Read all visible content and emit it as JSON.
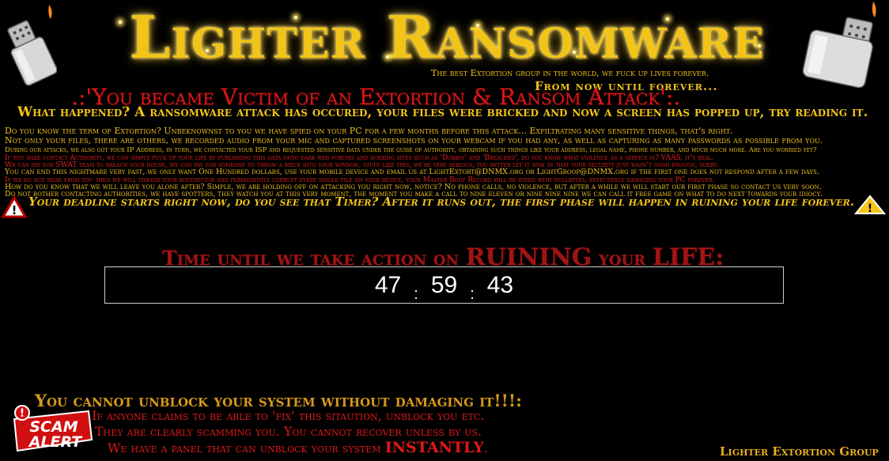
{
  "header": {
    "title": "Lighter Ransomware",
    "tagline_1": "The best Extortion group in the world, we fuck up lives forever.",
    "tagline_2": "From now until forever...",
    "victim_banner": ".:'You became Victim of an Extortion & Ransom Attack':.",
    "what_happened": "What happened? A ransomware attack has occured, your files were bricked and now a screen has popped up, try reading it."
  },
  "body_lines": [
    {
      "text": "Do you know the term of Extortion? Unbeknownst to you we have spied on your PC for a few months before this attack... Exfiltrating many sensitive things, that's right.",
      "color": "yel"
    },
    {
      "text": "Not only your files, there are others, we recorded audio from your mic and captured screenshots on your webcam if you had any, as well as capturing as many passwords as possible from you.",
      "color": "yel"
    },
    {
      "text": "During our attacks, we also got your IP Address, in turn, we contacted your ISP and requested sensitive data under the guise of authority, obtaining such things like your address, legal name, phone number, and much much more. Are you worried yet?",
      "color": "yel"
    },
    {
      "text": "If you dare contact Authority, we can simply fuck up your life by publishing this data onto dark web forums and doxxing sites such as 'Doxbin' and 'Breached', do you know what violence as a service is? VAAS, it's real.",
      "color": "red"
    },
    {
      "text": "We can pay for SWAT team to breach your house, we can pay for someone to throw a brick into your window, stuff like this, we're very serious, you better let it sink in that your security just wasn't good enough, sorry.",
      "color": "red"
    },
    {
      "text": "You can end this nightmare very fast,  we only want One Hundred dollars, use your mobile device and email us at LightExtort@DNMX.org or LightGroop@DNMX.org if the first one does not respond after a few days.",
      "color": "yel"
    },
    {
      "text": "If we do not hear from you then we will thrash your bootsector and permanently corrupt every single file on your device, your Master Boot Record will be wiped with nullbytes, effectively damaging your PC forever.",
      "color": "red"
    },
    {
      "text": "How do you know that we will leave you alone after? Simple, we are holding off on attacking you right now, notice? No phone calls, no violence, but after a while we will start our first phase so contact us very soon.",
      "color": "yel"
    },
    {
      "text": "Do not bother contacting authorities, we have spotters, they watch you at this very moment, the moment you make a call to nine eleven or nine nine nine we can call it free game on what to do next towards your idiocy.",
      "color": "yel"
    }
  ],
  "deadline": "Your deadline starts right now, do you see that Timer? After it runs out, the first phase will happen in ruining your life forever.",
  "timer": {
    "heading_1": "Time until we take action on ",
    "heading_ruining": "RUINING",
    "heading_2": " your ",
    "heading_life": "LIFE:",
    "hours": "47",
    "minutes": "59",
    "seconds": "43",
    "separator": ":"
  },
  "warning": {
    "heading": "You cannot unblock your system without damaging it!!!:",
    "line_1": "If anyone claims to be able to 'fix' this sitaution, unblock you etc.",
    "line_2": "They are clearly scamming you. You cannot recover unless by us.",
    "line_3a": "We have a panel that can unblock your system ",
    "line_3b": "INSTANTLY",
    "line_3c": ".",
    "badge_line_1": "SCAM",
    "badge_line_2": "ALERT",
    "badge_mark": "!"
  },
  "footer": "Lighter Extortion Group",
  "colors": {
    "gold": "#f2c418",
    "red": "#e01818",
    "dark_red": "#a01414",
    "background": "#000000"
  },
  "icons": [
    "lighter-left-icon",
    "lighter-right-icon",
    "warning-triangle-left-icon",
    "warning-triangle-right-icon",
    "scam-alert-icon"
  ]
}
